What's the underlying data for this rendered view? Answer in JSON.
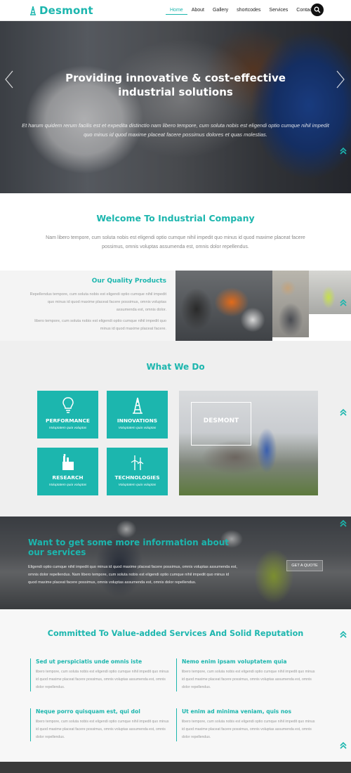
{
  "brand": {
    "name": "Desmont",
    "accent": "#1cb6ae"
  },
  "nav": {
    "items": [
      "Home",
      "About",
      "Gallery",
      "shortcodes",
      "Services",
      "Contact"
    ],
    "active_index": 0,
    "search_icon": "search-icon"
  },
  "hero": {
    "title_line1": "Providing innovative & cost-effective",
    "title_line2": "industrial solutions",
    "text": "Et harum quidem rerum facilis est et expedita distinctio nam libero tempore, cum soluta nobis est eligendi optio cumque nihil impedit quo minus id quod maxime placeat facere possimus dolores et quas molestias."
  },
  "welcome": {
    "title": "Welcome To Industrial Company",
    "text": "Nam libero tempore, cum soluta nobis est eligendi optio cumque nihil impedit quo minus id quod maxime placeat facere possimus, omnis voluptas assumenda est, omnis dolor repellendus."
  },
  "quality": {
    "title": "Our Quality Products",
    "para1": "Repellendus tempore, cum soluta nobis est eligendi optio cumque nihil impedit quo minus id quod maxime placeat facere possimus, omnis voluptas assumenda est, omnis dolor.",
    "para2": "libero tempore, cum soluta nobis est eligendi optio cumque nihil impedit quo minus id quod maxime placeat facere."
  },
  "what_we_do": {
    "title": "What We Do",
    "tiles": [
      {
        "title": "PERFORMANCE",
        "subtitle": "Voluptatem quia voluptas",
        "icon": "lightbulb-icon"
      },
      {
        "title": "INNOVATIONS",
        "subtitle": "Voluptatem quia voluptas",
        "icon": "oil-rig-icon"
      },
      {
        "title": "RESEARCH",
        "subtitle": "Voluptatem quia voluptas",
        "icon": "factory-icon"
      },
      {
        "title": "TECHNOLOGIES",
        "subtitle": "Voluptatem quia voluptas",
        "icon": "wind-turbine-icon"
      }
    ],
    "image_label": "DESMONT"
  },
  "info": {
    "title_line1": "Want to get some more information about",
    "title_line2": "our services",
    "text": "Eligendi optio cumque nihil impedit quo minus id quod maxime placeat facere possimus, omnis voluptas assumenda est, omnis dolor repellendus. Nam libero tempore, cum soluta nobis est eligendi optio cumque nihil impedit quo minus id quod maxime placeat facere possimus, omnis voluptas assumenda est, omnis dolor repellendus.",
    "button": "GET A QUOTE"
  },
  "committed": {
    "title": "Committed To Value-added Services And Solid Reputation",
    "features": [
      {
        "title": "Sed ut perspiciatis unde omnis iste",
        "text": "libero tempore, cum soluta nobis est eligendi optio cumque nihil impedit quo minus id quod maxime placeat facere possimus, omnis voluptas assumenda est, omnis dolor repellendus."
      },
      {
        "title": "Nemo enim ipsam voluptatem quia",
        "text": "libero tempore, cum soluta nobis est eligendi optio cumque nihil impedit quo minus id quod maxime placeat facere possimus, omnis voluptas assumenda est, omnis dolor repellendus."
      },
      {
        "title": "Neque porro quisquam est, qui dol",
        "text": "libero tempore, cum soluta nobis est eligendi optio cumque nihil impedit quo minus id quod maxime placeat facere possimus, omnis voluptas assumenda est, omnis dolor repellendus."
      },
      {
        "title": "Ut enim ad minima veniam, quis nos",
        "text": "libero tempore, cum soluta nobis est eligendi optio cumque nihil impedit quo minus id quod maxime placeat facere possimus, omnis voluptas assumenda est, omnis dolor repellendus."
      }
    ]
  }
}
